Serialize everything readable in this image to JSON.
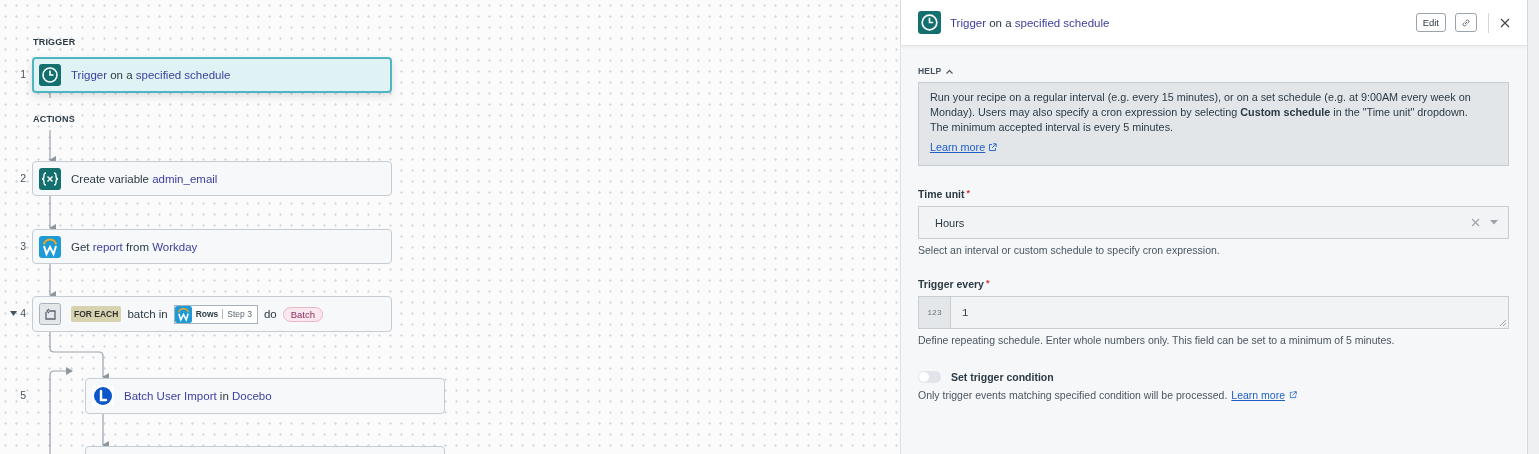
{
  "canvas": {
    "trigger_label": "TRIGGER",
    "actions_label": "ACTIONS",
    "steps": [
      {
        "kind": "simple",
        "number": "1",
        "selected": true,
        "title": [
          {
            "kind": "keyword",
            "text": "Trigger"
          },
          {
            "kind": "plain",
            "text": " on a "
          },
          {
            "kind": "keyword",
            "text": "specified schedule"
          }
        ]
      },
      {
        "kind": "simple",
        "number": "2",
        "selected": false,
        "title": [
          {
            "kind": "plain",
            "text": "Create variable "
          },
          {
            "kind": "keyword",
            "text": "admin_email"
          }
        ]
      },
      {
        "kind": "simple",
        "number": "3",
        "selected": false,
        "title": [
          {
            "kind": "plain",
            "text": "Get "
          },
          {
            "kind": "keyword",
            "text": "report"
          },
          {
            "kind": "plain",
            "text": " from "
          },
          {
            "kind": "keyword",
            "text": "Workday"
          }
        ]
      },
      {
        "kind": "foreach",
        "number": "4",
        "selected": false,
        "expanded": true,
        "badge": "FOR EACH",
        "text_before": "batch in",
        "pill": {
          "field": "Rows",
          "step": "Step 3"
        },
        "text_after": "do",
        "variable": "Batch"
      },
      {
        "kind": "simple",
        "number": "5",
        "selected": false,
        "title": [
          {
            "kind": "keyword",
            "text": "Batch User Import"
          },
          {
            "kind": "plain",
            "text": " in "
          },
          {
            "kind": "keyword",
            "text": "Docebo"
          }
        ]
      },
      {
        "kind": "partial",
        "selected": false
      }
    ]
  },
  "panel": {
    "title": [
      {
        "kind": "keyword",
        "text": "Trigger"
      },
      {
        "kind": "plain",
        "text": " on a "
      },
      {
        "kind": "keyword",
        "text": "specified schedule"
      }
    ],
    "edit_button": "Edit",
    "help": {
      "label": "HELP",
      "expanded": true,
      "paragraphs": [
        "Run your recipe on a regular interval (e.g. every 15 minutes), or on a set schedule (e.g. at 9:00AM every week on Monday). Users may also specify a cron expression by selecting **Custom schedule** in the \"Time unit\" dropdown.",
        "The minimum accepted interval is every 5 minutes."
      ],
      "link": "Learn more"
    },
    "fields": [
      {
        "kind": "select",
        "label": "Time unit",
        "required_mark": "*",
        "value": "Hours",
        "hint": "Select an interval or custom schedule to specify cron expression."
      },
      {
        "kind": "number",
        "label": "Trigger every",
        "required_mark": "*",
        "prefix": "123",
        "value": "1",
        "hint": "Define repeating schedule. Enter whole numbers only. This field can be set to a minimum of 5 minutes."
      },
      {
        "kind": "toggle",
        "label": "Set trigger condition",
        "on": false,
        "hint": "Only trigger events matching specified condition will be processed.",
        "link": "Learn more"
      }
    ]
  }
}
